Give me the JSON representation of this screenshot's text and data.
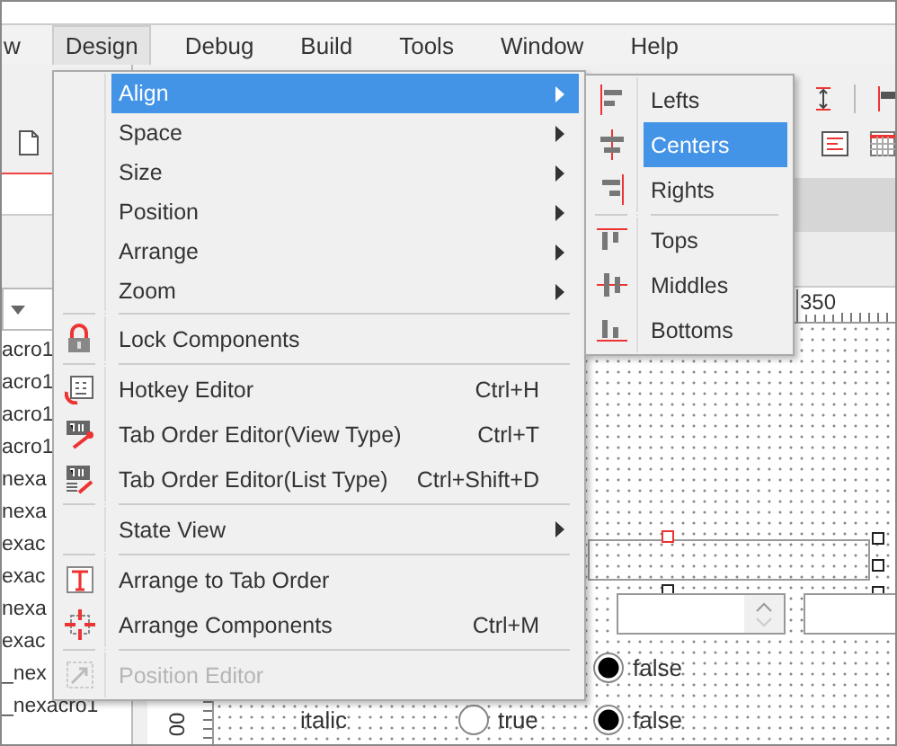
{
  "menubar": [
    {
      "label": "w",
      "selected": false
    },
    {
      "label": "Design",
      "selected": true
    },
    {
      "label": "Debug",
      "selected": false
    },
    {
      "label": "Build",
      "selected": false
    },
    {
      "label": "Tools",
      "selected": false
    },
    {
      "label": "Window",
      "selected": false
    },
    {
      "label": "Help",
      "selected": false
    }
  ],
  "explorer": {
    "items": [
      "acro1",
      "acro1",
      "acro1",
      "acro1",
      "nexa",
      "nexa",
      "exac",
      "exac",
      "nexa",
      "exac",
      "_nex",
      "_nexacro1"
    ]
  },
  "design_menu": {
    "items": [
      {
        "kind": "plain",
        "label": "Align",
        "submenu": true,
        "selected": true,
        "disabled": false
      },
      {
        "kind": "plain",
        "label": "Space",
        "submenu": true,
        "selected": false,
        "disabled": false
      },
      {
        "kind": "plain",
        "label": "Size",
        "submenu": true,
        "selected": false,
        "disabled": false
      },
      {
        "kind": "plain",
        "label": "Position",
        "submenu": true,
        "selected": false,
        "disabled": false
      },
      {
        "kind": "plain",
        "label": "Arrange",
        "submenu": true,
        "selected": false,
        "disabled": false
      },
      {
        "kind": "plain",
        "label": "Zoom",
        "submenu": true,
        "selected": false,
        "disabled": false
      },
      {
        "kind": "separator"
      },
      {
        "kind": "lock",
        "label": "Lock Components",
        "selected": false,
        "disabled": false
      },
      {
        "kind": "separator"
      },
      {
        "kind": "keyboard",
        "label": "Hotkey Editor",
        "shortcut": "Ctrl+H",
        "selected": false,
        "disabled": false
      },
      {
        "kind": "tabview",
        "label": "Tab Order Editor(View Type)",
        "shortcut": "Ctrl+T",
        "selected": false,
        "disabled": false
      },
      {
        "kind": "tablist",
        "label": "Tab Order Editor(List Type)",
        "shortcut": "Ctrl+Shift+D",
        "selected": false,
        "disabled": false
      },
      {
        "kind": "separator"
      },
      {
        "kind": "plain",
        "label": "State View",
        "submenu": true,
        "selected": false,
        "disabled": false
      },
      {
        "kind": "separator"
      },
      {
        "kind": "taborder",
        "label": "Arrange to Tab Order",
        "selected": false,
        "disabled": false
      },
      {
        "kind": "arrange",
        "label": "Arrange Components",
        "shortcut": "Ctrl+M",
        "selected": false,
        "disabled": false
      },
      {
        "kind": "separator"
      },
      {
        "kind": "position",
        "label": "Position Editor",
        "selected": false,
        "disabled": true
      }
    ]
  },
  "align_submenu": {
    "items": [
      {
        "kind": "alignleft",
        "label": "Lefts",
        "selected": false
      },
      {
        "kind": "aligncenter",
        "label": "Centers",
        "selected": true
      },
      {
        "kind": "alignright",
        "label": "Rights",
        "selected": false
      },
      {
        "kind": "separator"
      },
      {
        "kind": "aligntop",
        "label": "Tops",
        "selected": false
      },
      {
        "kind": "alignmiddle",
        "label": "Middles",
        "selected": false
      },
      {
        "kind": "alignbottom",
        "label": "Bottoms",
        "selected": false
      }
    ]
  },
  "canvas": {
    "ruler_x_label": "350",
    "ruler_y_label": "00",
    "rows": [
      {
        "radios": [
          {
            "label": "false",
            "selected": true
          }
        ]
      },
      {
        "text": "italic",
        "radios": [
          {
            "label": "true",
            "selected": false
          },
          {
            "label": "false",
            "selected": true
          }
        ]
      }
    ]
  }
}
